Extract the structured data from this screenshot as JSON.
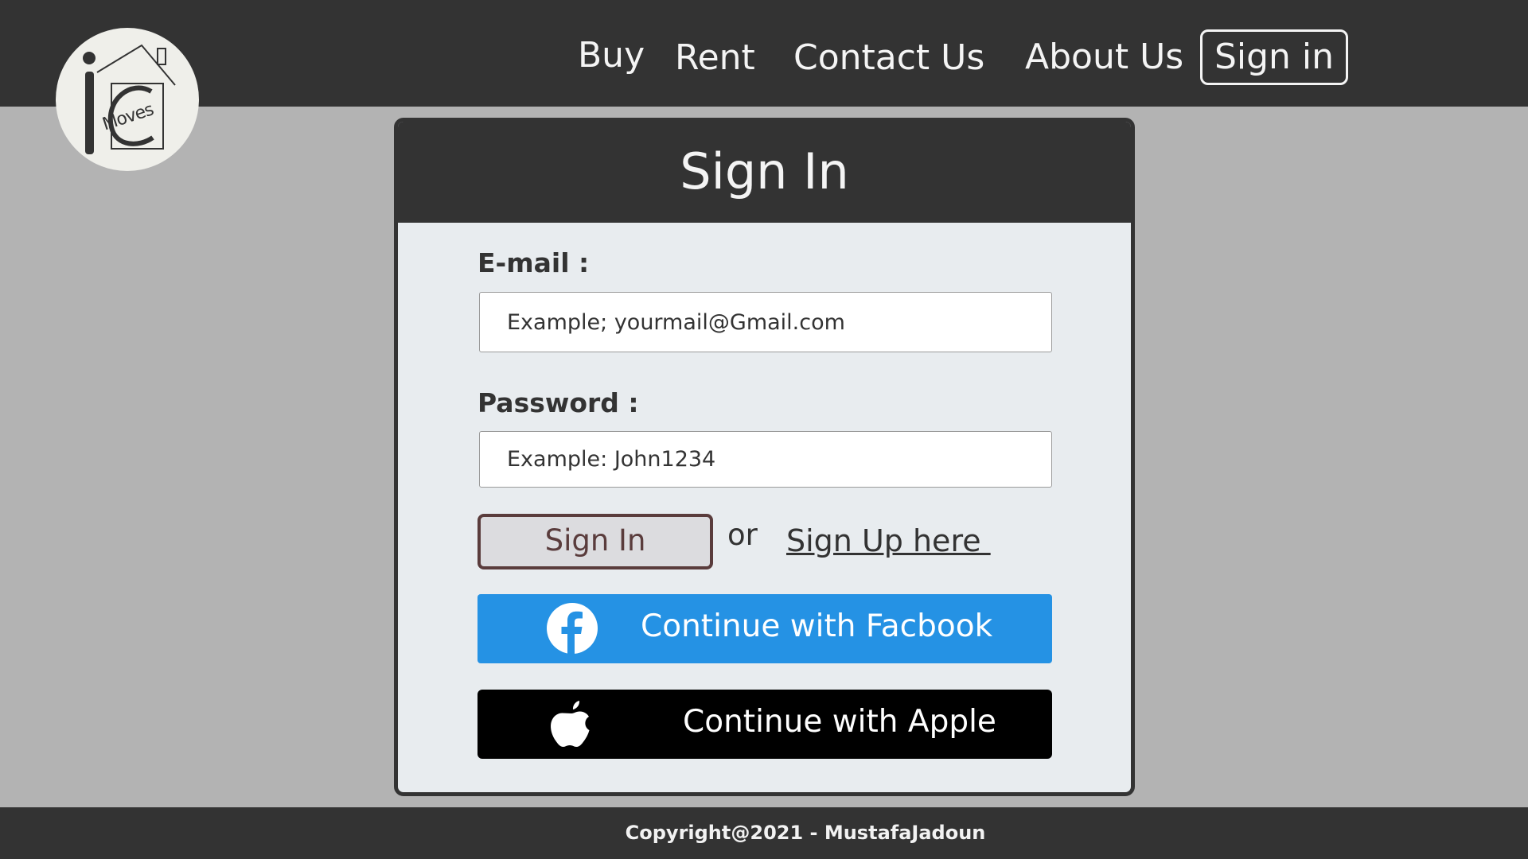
{
  "brand": {
    "logo_text": "Moves",
    "logo_icon": "house-logo-icon"
  },
  "nav": {
    "buy": "Buy",
    "rent": "Rent",
    "contact": "Contact Us",
    "about": "About Us",
    "signin": "Sign in"
  },
  "card": {
    "title": "Sign In",
    "email_label": "E-mail :",
    "email_placeholder": "Example; yourmail@Gmail.com",
    "password_label": "Password :",
    "password_placeholder": "Example: John1234",
    "signin_button": "Sign In",
    "or_text": "or",
    "signup_link": "Sign Up here ",
    "facebook_button": "Continue with Facbook",
    "apple_button": "Continue with Apple"
  },
  "footer": {
    "copyright": "Copyright@2021 - MustafaJadoun"
  },
  "colors": {
    "header_bg": "#333333",
    "page_bg": "#b3b3b3",
    "card_body_bg": "#e8ecef",
    "facebook_blue": "#2592e4",
    "apple_black": "#000000",
    "signin_border": "#5a3c3c"
  }
}
